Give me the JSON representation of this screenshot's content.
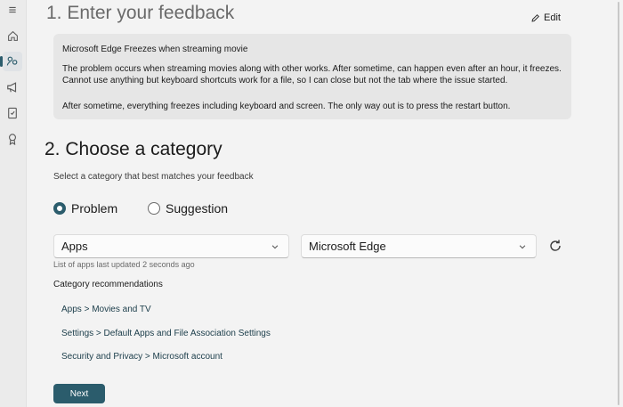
{
  "nav": {
    "items": [
      {
        "icon": "hamburger-menu-icon",
        "glyph": "≡"
      },
      {
        "icon": "home-icon"
      },
      {
        "icon": "feedback-icon"
      },
      {
        "icon": "announcements-icon"
      },
      {
        "icon": "quests-icon"
      },
      {
        "icon": "achievements-icon"
      }
    ]
  },
  "section1": {
    "title": "1. Enter your feedback",
    "edit_label": "Edit",
    "summary": "Microsoft Edge Freezes when streaming movie",
    "details_1": "The problem occurs when streaming movies along with other works. After sometime, can happen even after an hour, it freezes. Cannot use anything but keyboard shortcuts work for a file, so I can close but not the tab where the issue started.",
    "details_2": "After sometime, everything freezes including keyboard and screen. The only way out is to press the restart button."
  },
  "section2": {
    "title": "2. Choose a category",
    "hint": "Select a category that best matches your feedback",
    "radio_problem": "Problem",
    "radio_suggestion": "Suggestion",
    "selected_radio": "Problem",
    "dropdown_category": "Apps",
    "dropdown_subcategory": "Microsoft Edge",
    "updated_note": "List of apps last updated 2 seconds ago",
    "recommendations_title": "Category recommendations",
    "recommendations": [
      "Apps > Movies and TV",
      "Settings > Default Apps and File Association Settings",
      "Security and Privacy > Microsoft account"
    ],
    "next_label": "Next"
  },
  "colors": {
    "accent": "#2b5c6c",
    "background": "#f3f3f3",
    "card": "#e6e6e6"
  }
}
